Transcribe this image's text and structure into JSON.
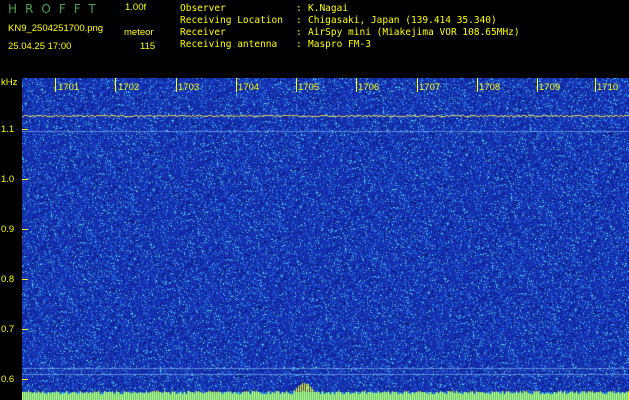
{
  "app": {
    "title": "HROFFT",
    "version": "1.00f",
    "filename": "KN9_2504251700.png",
    "mode_label": "meteor",
    "datetime": "25.04.25 17:00",
    "count": "115"
  },
  "header": {
    "rows": [
      {
        "key": "Observer",
        "value": "K.Nagai"
      },
      {
        "key": "Receiving Location",
        "value": "Chigasaki, Japan (139.414 35.340)"
      },
      {
        "key": "Receiver",
        "value": "AirSpy mini (Miakejima VOR 108.65MHz)"
      },
      {
        "key": "Receiving antenna",
        "value": "Maspro FM-3"
      }
    ]
  },
  "axes": {
    "y_unit": "kHz",
    "x_ticks": [
      "1701",
      "1702",
      "1703",
      "1704",
      "1705",
      "1706",
      "1707",
      "1708",
      "1709",
      "1710"
    ],
    "y_ticks": [
      "1.1",
      "1.0",
      "0.9",
      "0.8",
      "0.7",
      "0.6"
    ]
  },
  "colors": {
    "background": "#000000",
    "text": "#ffff00",
    "title": "#4aa34a",
    "spectrum_base": "#1a2fb0"
  }
}
